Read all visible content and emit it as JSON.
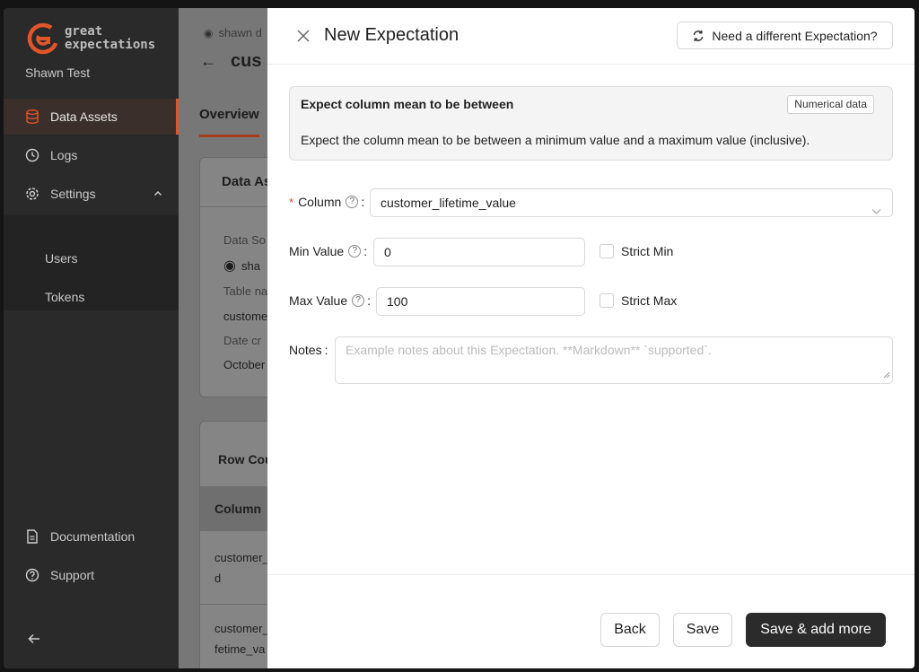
{
  "sidebar": {
    "logo_line1": "great",
    "logo_line2": "expectations",
    "org_name": "Shawn Test",
    "items": [
      {
        "label": "Data Assets"
      },
      {
        "label": "Logs"
      },
      {
        "label": "Settings"
      }
    ],
    "sub_items": [
      {
        "label": "Users"
      },
      {
        "label": "Tokens"
      }
    ],
    "bottom_items": [
      {
        "label": "Documentation"
      },
      {
        "label": "Support"
      }
    ],
    "accent": "#e0562b"
  },
  "page": {
    "crumb": "shawn d",
    "title": "cus",
    "tab": "Overview",
    "card1_title": "Data As",
    "card1_labels": [
      "Data So",
      "Table na",
      "Date cr"
    ],
    "card1_values": [
      "sha",
      "custome",
      "October"
    ],
    "card2_title": "Row Cou",
    "table_header": "Column",
    "rows": [
      "customer_i d",
      "customer_li fetime_va"
    ]
  },
  "drawer": {
    "title": "New Expectation",
    "different_button": "Need a different Expectation?",
    "card": {
      "title": "Expect column mean to be between",
      "tag": "Numerical data",
      "description": "Expect the column mean to be between a minimum value and a maximum value (inclusive)."
    },
    "fields": {
      "column_label": "Column",
      "column_value": "customer_lifetime_value",
      "min_label": "Min Value",
      "min_value": "0",
      "strict_min": "Strict Min",
      "max_label": "Max Value",
      "max_value": "100",
      "strict_max": "Strict Max",
      "notes_label": "Notes",
      "notes_placeholder": "Example notes about this Expectation. **Markdown** `supported`."
    },
    "footer": {
      "back": "Back",
      "save": "Save",
      "save_add": "Save & add more"
    }
  }
}
